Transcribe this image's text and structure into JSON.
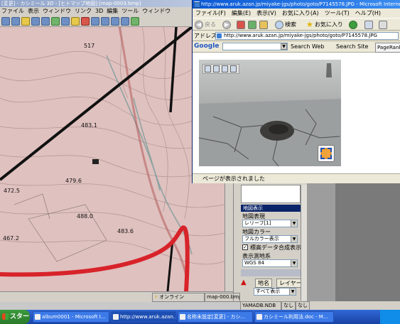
{
  "kashmir": {
    "title": "[変更] - カシミール 3D - [ヒトマップ地図] [map-0003.bmp]",
    "menu": [
      "ファイル",
      "表示",
      "ウィンドウ",
      "リンク",
      "3D",
      "編集",
      "ツール",
      "ウィンドウ"
    ],
    "elevations": [
      "517",
      "483.1",
      "472.5",
      "479.6",
      "488.0",
      "483.6",
      "467.2"
    ],
    "status": {
      "online": "オンライン",
      "map_file": "map-000.bmp",
      "database": "YAMADB.NDB",
      "flag1": "なし",
      "flag2": "なし"
    }
  },
  "ie": {
    "title": "http://www.aruk.azan.jp/miyake-jgs/photo/goto/P7145578.JPG - Microsoft Internet Explorer",
    "menu": [
      "ファイル(F)",
      "編集(E)",
      "表示(V)",
      "お気に入り(A)",
      "ツール(T)",
      "ヘルプ(H)"
    ],
    "toolbar": {
      "back": "戻る",
      "search": "検索",
      "favorites": "お気に入り"
    },
    "address": {
      "label": "アドレス(D)",
      "url": "http://www.aruk.azan.jp/miyake-jgs/photo/goto/P7145578.JPG"
    },
    "google_bar": {
      "logo": "Google",
      "search_web": "Search Web",
      "search_site": "Search Site",
      "pagerank": "PageRank"
    },
    "status": "ページが表示されました"
  },
  "side_panel": {
    "section1": "地図表示",
    "map_display_label": "地図表現",
    "map_display_value": "レリーフ[1]",
    "color_label": "地図カラー",
    "color_value": "フルカラー表示",
    "elev_checkbox": "標高データ合成表示",
    "datum_label": "表示測地系",
    "datum_value": "WGS 84",
    "section2": "地名",
    "col_name": "地名",
    "col_layer": "レイヤー",
    "filter_value": "すべて表示"
  },
  "taskbar": {
    "start": "スタート",
    "tasks": [
      "album0001 - Microsoft I...",
      "http://www.aruk.azan...",
      "名称未設定[変更] - カシ...",
      "カシミール利用法.doc - M..."
    ]
  },
  "colors": {
    "ie_title": "#0a58d4",
    "taskbar": "#1941a5",
    "start": "#2a7a2a",
    "red_route": "#d8232a"
  }
}
